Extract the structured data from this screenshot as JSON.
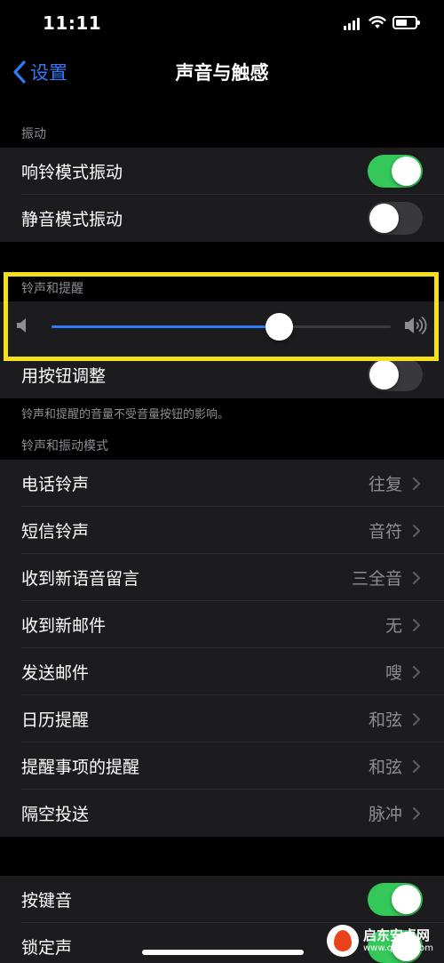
{
  "status_bar": {
    "time": "11:11"
  },
  "nav": {
    "back_label": "设置",
    "title": "声音与触感"
  },
  "vibration": {
    "header": "振动",
    "rows": [
      {
        "label": "响铃模式振动",
        "on": true
      },
      {
        "label": "静音模式振动",
        "on": false
      }
    ]
  },
  "ringer": {
    "header": "铃声和提醒",
    "volume_level": 0.67,
    "change_with_buttons": {
      "label": "用按钮调整",
      "on": false
    },
    "footer": "铃声和提醒的音量不受音量按钮的影响。"
  },
  "patterns": {
    "header": "铃声和振动模式",
    "rows": [
      {
        "label": "电话铃声",
        "value": "往复"
      },
      {
        "label": "短信铃声",
        "value": "音符"
      },
      {
        "label": "收到新语音留言",
        "value": "三全音"
      },
      {
        "label": "收到新邮件",
        "value": "无"
      },
      {
        "label": "发送邮件",
        "value": "嗖"
      },
      {
        "label": "日历提醒",
        "value": "和弦"
      },
      {
        "label": "提醒事项的提醒",
        "value": "和弦"
      },
      {
        "label": "隔空投送",
        "value": "脉冲"
      }
    ]
  },
  "system_sounds": {
    "rows": [
      {
        "label": "按键音",
        "on": true
      },
      {
        "label": "锁定声",
        "on": true
      }
    ]
  },
  "watermark": {
    "main": "启东安卓网",
    "sub": "www.qdltcl.com"
  },
  "colors": {
    "accent": "#2f7bf5",
    "toggle_on": "#34c759",
    "highlight": "#f5e01c",
    "cell_bg": "#1c1c1e"
  }
}
